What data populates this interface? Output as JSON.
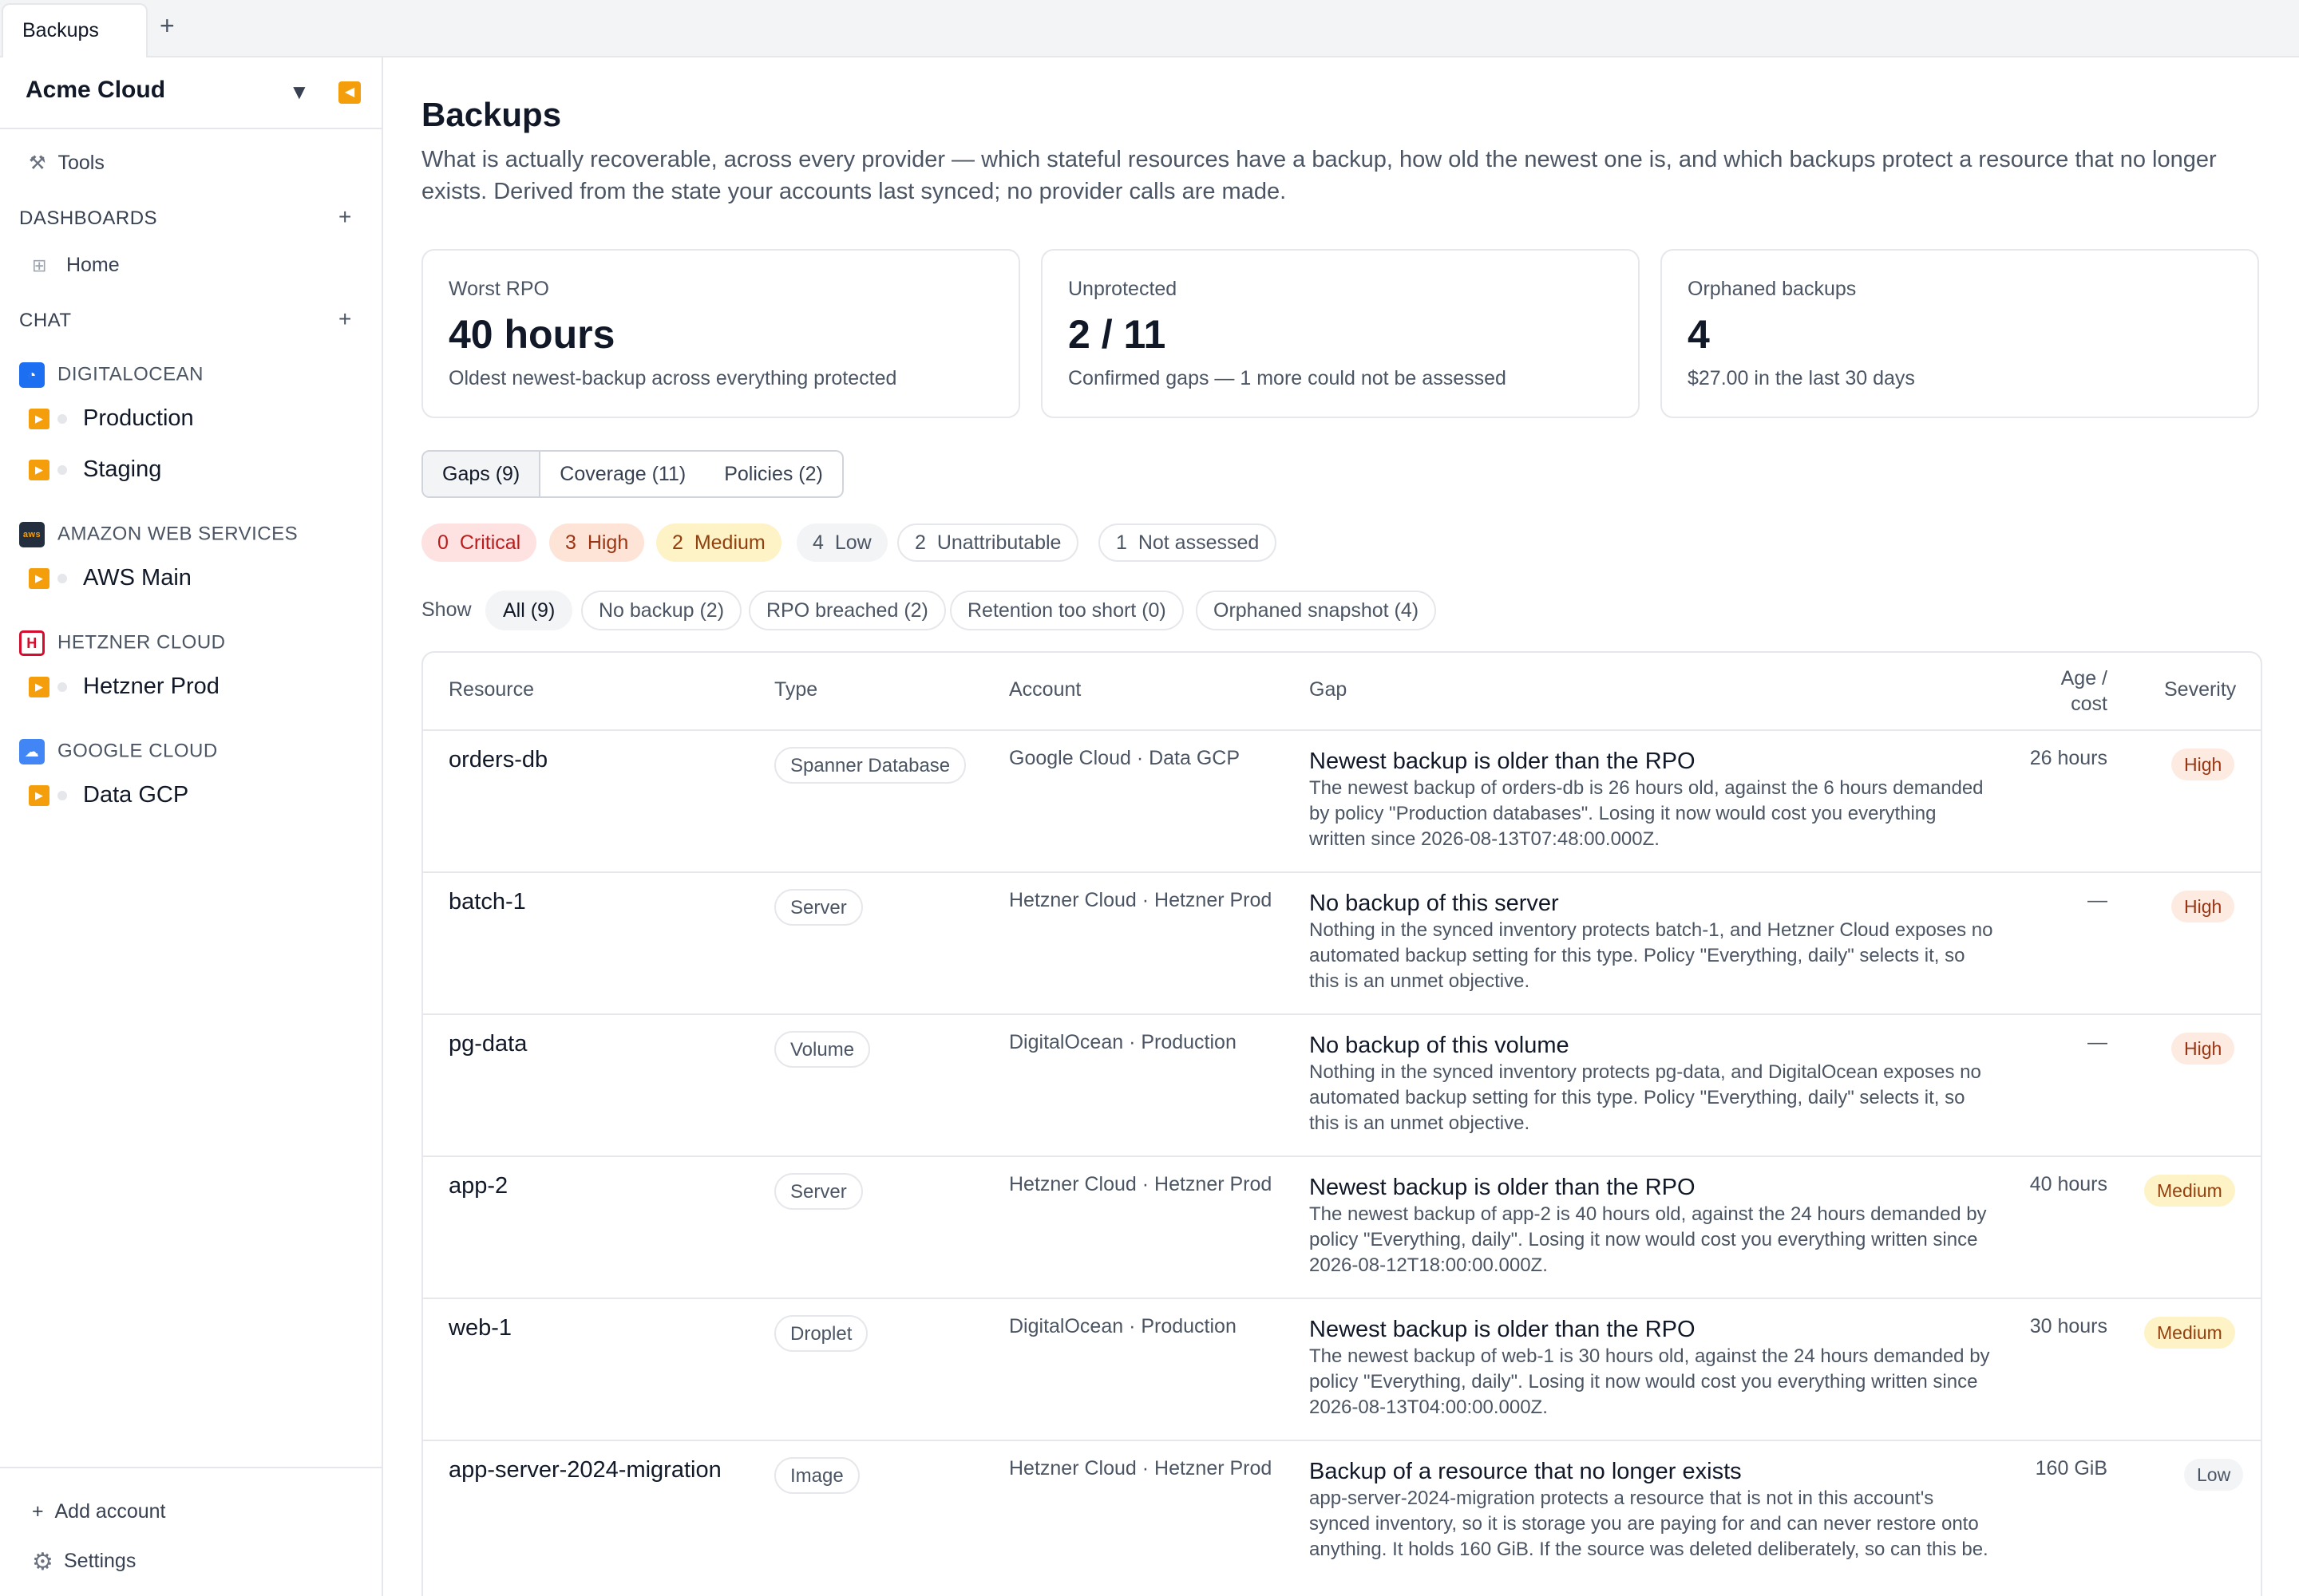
{
  "tabs": [
    {
      "label": "Backups"
    }
  ],
  "sidebar": {
    "workspace": "Acme Cloud",
    "tools_label": "Tools",
    "dashboards_label": "DASHBOARDS",
    "home_label": "Home",
    "chat_label": "CHAT",
    "providers": [
      {
        "name": "DIGITALOCEAN",
        "color": "#1d6ff2",
        "accounts": [
          "Production",
          "Staging"
        ]
      },
      {
        "name": "AMAZON WEB SERVICES",
        "color": "#232f3e",
        "logo_text": "aws",
        "accounts": [
          "AWS Main"
        ]
      },
      {
        "name": "HETZNER CLOUD",
        "color": "#d50c2d",
        "logo_text": "H",
        "accounts": [
          "Hetzner Prod"
        ]
      },
      {
        "name": "GOOGLE CLOUD",
        "color": "#4285f4",
        "accounts": [
          "Data GCP"
        ]
      }
    ],
    "add_account_label": "Add account",
    "settings_label": "Settings"
  },
  "page": {
    "title": "Backups",
    "description": "What is actually recoverable, across every provider — which stateful resources have a backup, how old the newest one is, and which backups protect a resource that no longer exists. Derived from the state your accounts last synced; no provider calls are made."
  },
  "cards": [
    {
      "label": "Worst RPO",
      "value": "40 hours",
      "sub": "Oldest newest-backup across everything protected"
    },
    {
      "label": "Unprotected",
      "value": "2 / 11",
      "sub": "Confirmed gaps — 1 more could not be assessed"
    },
    {
      "label": "Orphaned backups",
      "value": "4",
      "sub": "$27.00 in the last 30 days"
    }
  ],
  "view_tabs": [
    "Gaps (9)",
    "Coverage (11)",
    "Policies (2)"
  ],
  "severity_pills": {
    "critical": {
      "count": "0",
      "label": "Critical"
    },
    "high": {
      "count": "3",
      "label": "High"
    },
    "medium": {
      "count": "2",
      "label": "Medium"
    },
    "low": {
      "count": "4",
      "label": "Low"
    },
    "unattributable": {
      "count": "2",
      "label": "Unattributable"
    },
    "not_assessed": {
      "count": "1",
      "label": "Not assessed"
    }
  },
  "filters": {
    "show_label": "Show",
    "options": [
      "All (9)",
      "No backup (2)",
      "RPO breached (2)",
      "Retention too short (0)",
      "Orphaned snapshot (4)"
    ]
  },
  "table": {
    "headers": {
      "resource": "Resource",
      "type": "Type",
      "account": "Account",
      "gap": "Gap",
      "age_line1": "Age /",
      "age_line2": "cost",
      "severity": "Severity"
    },
    "rows": [
      {
        "resource": "orders-db",
        "type": "Spanner Database",
        "account": "Google Cloud · Data GCP",
        "gap_title": "Newest backup is older than the RPO",
        "gap_body": "The newest backup of orders-db is 26 hours old, against the 6 hours demanded by policy \"Production databases\". Losing it now would cost you everything written since 2026-08-13T07:48:00.000Z.",
        "age": "26 hours",
        "severity": "High"
      },
      {
        "resource": "batch-1",
        "type": "Server",
        "account": "Hetzner Cloud · Hetzner Prod",
        "gap_title": "No backup of this server",
        "gap_body": "Nothing in the synced inventory protects batch-1, and Hetzner Cloud exposes no automated backup setting for this type. Policy \"Everything, daily\" selects it, so this is an unmet objective.",
        "age": "—",
        "severity": "High"
      },
      {
        "resource": "pg-data",
        "type": "Volume",
        "account": "DigitalOcean · Production",
        "gap_title": "No backup of this volume",
        "gap_body": "Nothing in the synced inventory protects pg-data, and DigitalOcean exposes no automated backup setting for this type. Policy \"Everything, daily\" selects it, so this is an unmet objective.",
        "age": "—",
        "severity": "High"
      },
      {
        "resource": "app-2",
        "type": "Server",
        "account": "Hetzner Cloud · Hetzner Prod",
        "gap_title": "Newest backup is older than the RPO",
        "gap_body": "The newest backup of app-2 is 40 hours old, against the 24 hours demanded by policy \"Everything, daily\". Losing it now would cost you everything written since 2026-08-12T18:00:00.000Z.",
        "age": "40 hours",
        "severity": "Medium"
      },
      {
        "resource": "web-1",
        "type": "Droplet",
        "account": "DigitalOcean · Production",
        "gap_title": "Newest backup is older than the RPO",
        "gap_body": "The newest backup of web-1 is 30 hours old, against the 24 hours demanded by policy \"Everything, daily\". Losing it now would cost you everything written since 2026-08-13T04:00:00.000Z.",
        "age": "30 hours",
        "severity": "Medium"
      },
      {
        "resource": "app-server-2024-migration",
        "type": "Image",
        "account": "Hetzner Cloud · Hetzner Prod",
        "gap_title": "Backup of a resource that no longer exists",
        "gap_body": "app-server-2024-migration protects a resource that is not in this account's synced inventory, so it is storage you are paying for and can never restore onto anything. It holds 160 GiB. If the source was deleted deliberately, so can this be.",
        "age": "160 GiB",
        "severity": "Low"
      }
    ]
  }
}
